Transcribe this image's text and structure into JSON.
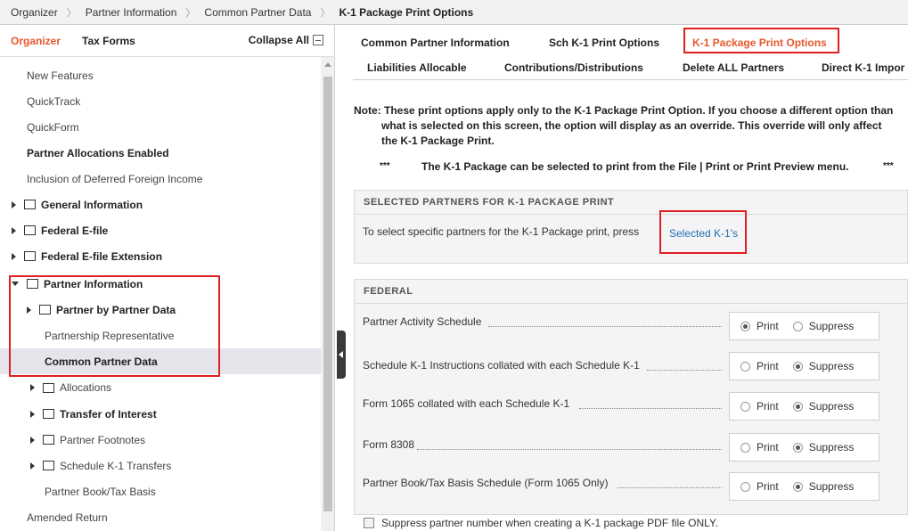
{
  "breadcrumb": {
    "items": [
      "Organizer",
      "Partner Information",
      "Common Partner Data"
    ],
    "current": "K-1 Package Print Options"
  },
  "sidebar": {
    "tab_organizer": "Organizer",
    "tab_tax_forms": "Tax Forms",
    "collapse_all": "Collapse All",
    "items": [
      {
        "label": "New Features"
      },
      {
        "label": "QuickTrack"
      },
      {
        "label": "QuickForm"
      },
      {
        "label": "Partner Allocations Enabled"
      },
      {
        "label": "Inclusion of Deferred Foreign Income"
      },
      {
        "label": "General Information"
      },
      {
        "label": "Federal E-file"
      },
      {
        "label": "Federal E-file Extension"
      },
      {
        "label": "Partner Information"
      },
      {
        "label": "Partner by Partner Data"
      },
      {
        "label": "Partnership Representative"
      },
      {
        "label": "Common Partner Data"
      },
      {
        "label": "Allocations"
      },
      {
        "label": "Transfer of Interest"
      },
      {
        "label": "Partner Footnotes"
      },
      {
        "label": "Schedule K-1 Transfers"
      },
      {
        "label": "Partner Book/Tax Basis"
      },
      {
        "label": "Amended Return"
      }
    ]
  },
  "tabs": {
    "row1": [
      "Common Partner Information",
      "Sch K-1 Print Options",
      "K-1 Package Print Options"
    ],
    "row2": [
      "Liabilities Allocable",
      "Contributions/Distributions",
      "Delete ALL Partners",
      "Direct K-1 Impor"
    ],
    "active": "K-1 Package Print Options"
  },
  "note": {
    "line1": "Note: These print options apply only to the K-1 Package Print Option. If you choose a different option than",
    "line2": "what is selected on this screen, the option will display as an override. This override will only affect",
    "line3": "the K-1 Package Print.",
    "stars": "***",
    "package_text": "The K-1 Package can be selected to print from the File | Print or Print Preview menu."
  },
  "selected_partners": {
    "header": "SELECTED PARTNERS FOR K-1 PACKAGE PRINT",
    "text": "To select specific partners for the K-1 Package print, press",
    "link": "Selected K-1's"
  },
  "federal": {
    "header": "FEDERAL",
    "print_label": "Print",
    "suppress_label": "Suppress",
    "rows": [
      {
        "label": "Partner Activity Schedule",
        "selected": "Print"
      },
      {
        "label": "Schedule K-1 Instructions collated with each Schedule K-1",
        "selected": "Suppress"
      },
      {
        "label": "Form 1065 collated with each Schedule K-1",
        "selected": "Suppress"
      },
      {
        "label": "Form 8308",
        "selected": "Suppress"
      },
      {
        "label": "Partner Book/Tax Basis Schedule (Form 1065 Only)",
        "selected": "Suppress"
      }
    ]
  },
  "suppress_partner_number": "Suppress partner number when creating a K-1 package PDF file ONLY."
}
